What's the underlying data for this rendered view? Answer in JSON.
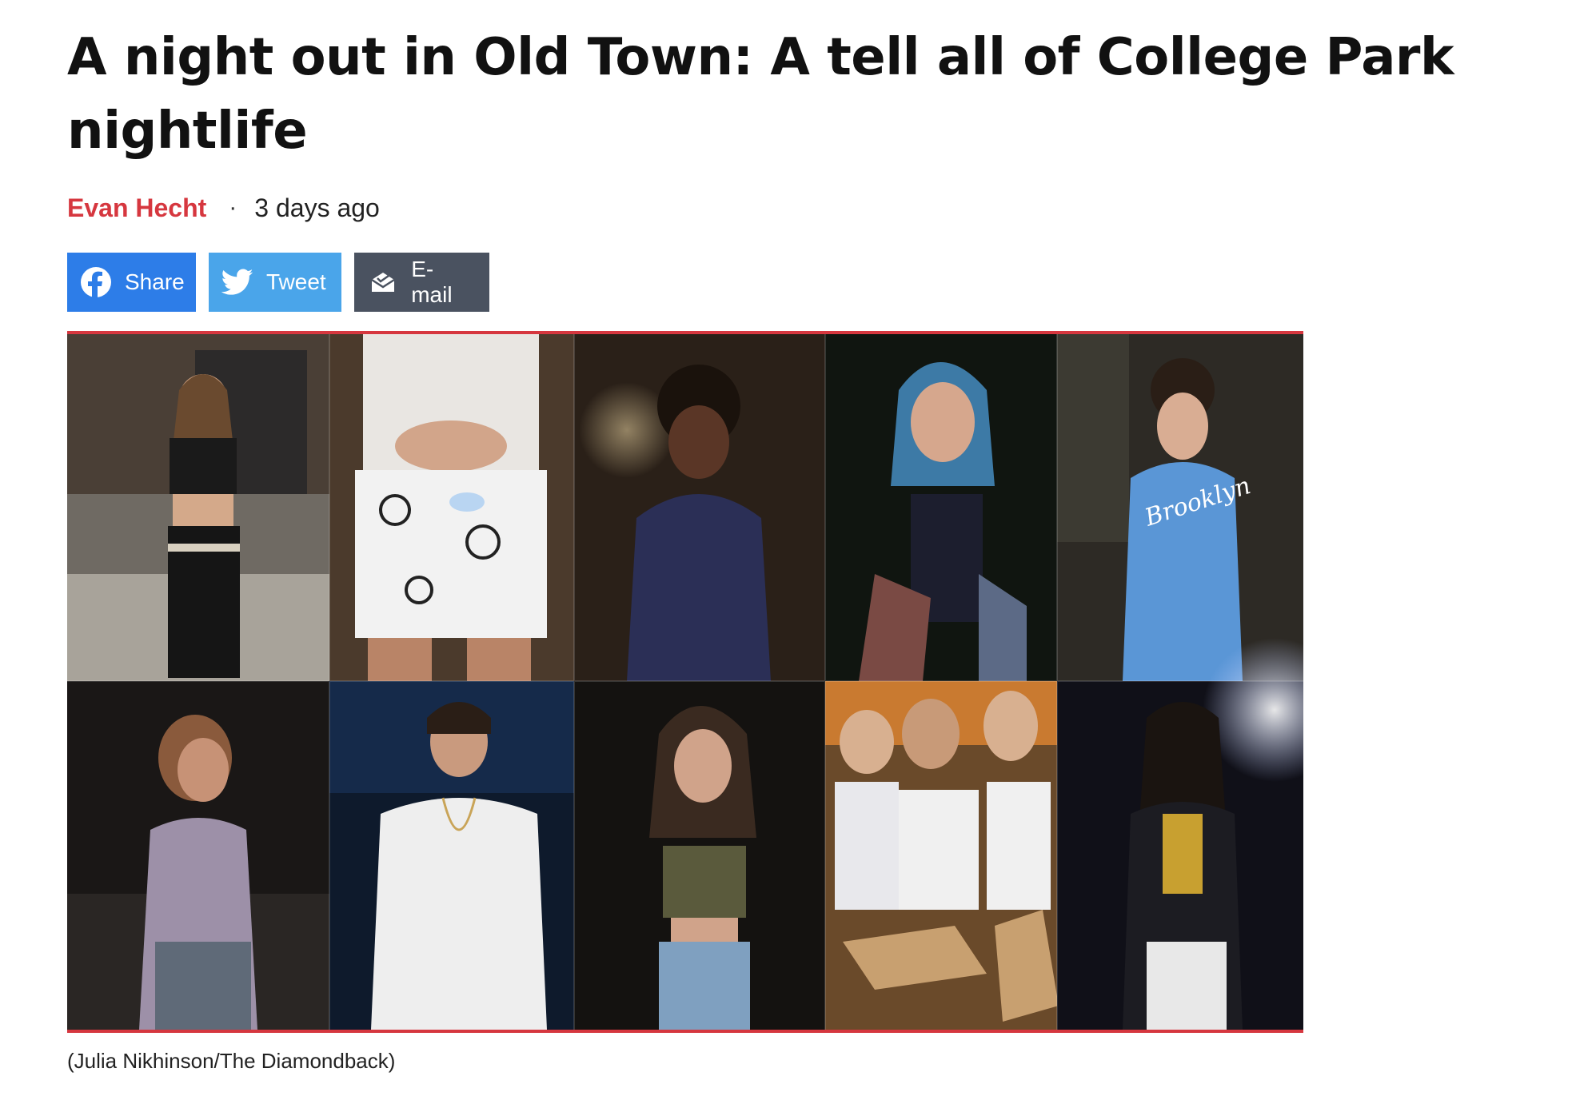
{
  "article": {
    "headline": "A night out in Old Town: A tell all of College Park nightlife",
    "author": "Evan Hecht",
    "separator": "·",
    "published": "3 days ago",
    "caption": "(Julia Nikhinson/The Diamondback)"
  },
  "share": {
    "facebook_label": "Share",
    "twitter_label": "Tweet",
    "email_label": "E-mail"
  },
  "colors": {
    "accent": "#d6373f",
    "facebook": "#2d7de8",
    "twitter": "#4aa5ea",
    "email": "#4a5260"
  },
  "photo": {
    "shirt_text": "Brooklyn"
  }
}
